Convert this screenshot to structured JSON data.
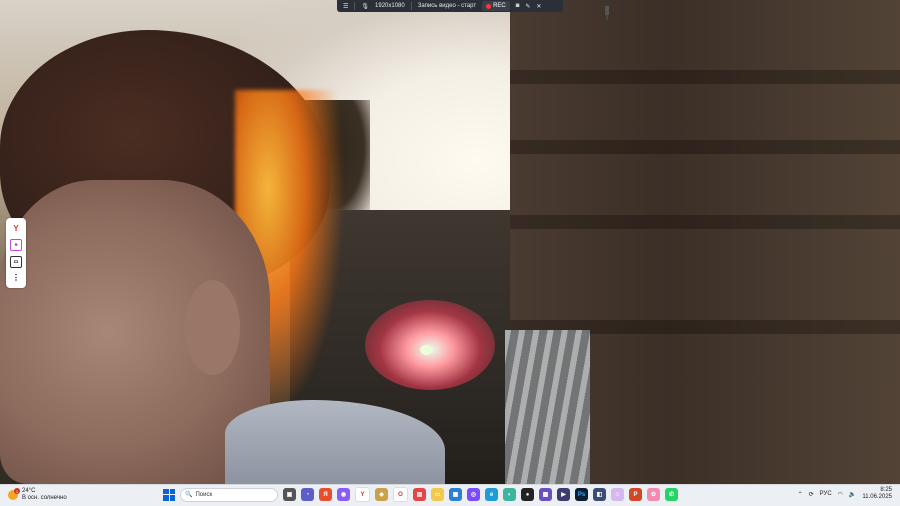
{
  "recorder": {
    "resolution": "1920x1080",
    "title": "Запись видео - старт",
    "rec_label": "REC"
  },
  "side_panel": {
    "icons": [
      "yandex-icon",
      "media-icon",
      "screen-icon",
      "more-icon"
    ]
  },
  "taskbar": {
    "weather_temp": "24°C",
    "weather_desc": "В осн. солнечно",
    "weather_badge": "1",
    "search_placeholder": "Поиск",
    "language": "РУС",
    "time": "8:25",
    "date": "11.06.2025"
  },
  "colors": {
    "start": "#0a64d6",
    "rec_dot": "#ff3535",
    "taskbar_bg": "#eceff4"
  }
}
